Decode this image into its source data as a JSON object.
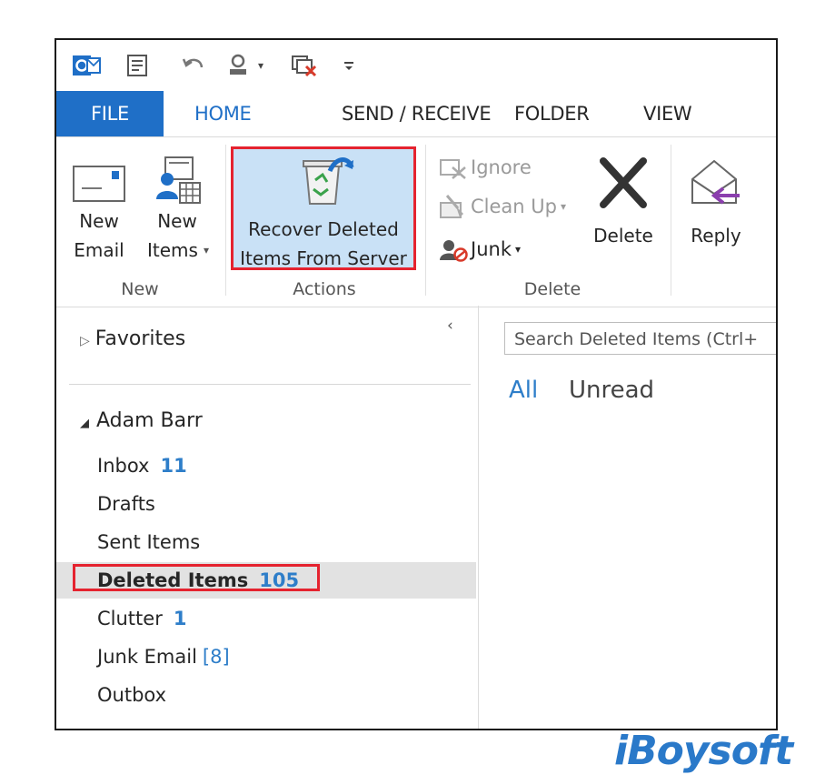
{
  "quick_access": {
    "icons": [
      "outlook-icon",
      "new-item-icon",
      "undo-icon",
      "contact-icon",
      "dropdown-arrow-icon",
      "window-close-icon",
      "customize-icon"
    ]
  },
  "tabs": [
    {
      "label": "FILE"
    },
    {
      "label": "HOME"
    },
    {
      "label": "SEND / RECEIVE"
    },
    {
      "label": "FOLDER"
    },
    {
      "label": "VIEW"
    }
  ],
  "ribbon": {
    "new_group": {
      "new_email_line1": "New",
      "new_email_line2": "Email",
      "new_items_line1": "New",
      "new_items_line2": "Items",
      "label": "New"
    },
    "actions_group": {
      "recover_line1": "Recover Deleted",
      "recover_line2": "Items From Server",
      "label": "Actions"
    },
    "delete_group": {
      "ignore": "Ignore",
      "clean_up": "Clean Up",
      "junk": "Junk",
      "delete": "Delete",
      "label": "Delete"
    },
    "respond_group": {
      "reply": "Reply"
    }
  },
  "folder_pane": {
    "favorites": "Favorites",
    "collapse_glyph": "‹",
    "account": "Adam Barr",
    "folders": [
      {
        "name": "Inbox",
        "count": "11"
      },
      {
        "name": "Drafts",
        "count": ""
      },
      {
        "name": "Sent Items",
        "count": ""
      },
      {
        "name": "Deleted Items",
        "count": "105"
      },
      {
        "name": "Clutter",
        "count": "1"
      },
      {
        "name": "Junk Email",
        "count": "[8]"
      },
      {
        "name": "Outbox",
        "count": ""
      }
    ]
  },
  "message_list": {
    "search_placeholder": "Search Deleted Items (Ctrl+",
    "filter_all": "All",
    "filter_unread": "Unread"
  },
  "watermark": "iBoysoft",
  "colors": {
    "accent": "#1f6fc7",
    "highlight_border": "#e5232f",
    "count_blue": "#2e7ec9",
    "selected_bg": "#e2e2e2"
  }
}
